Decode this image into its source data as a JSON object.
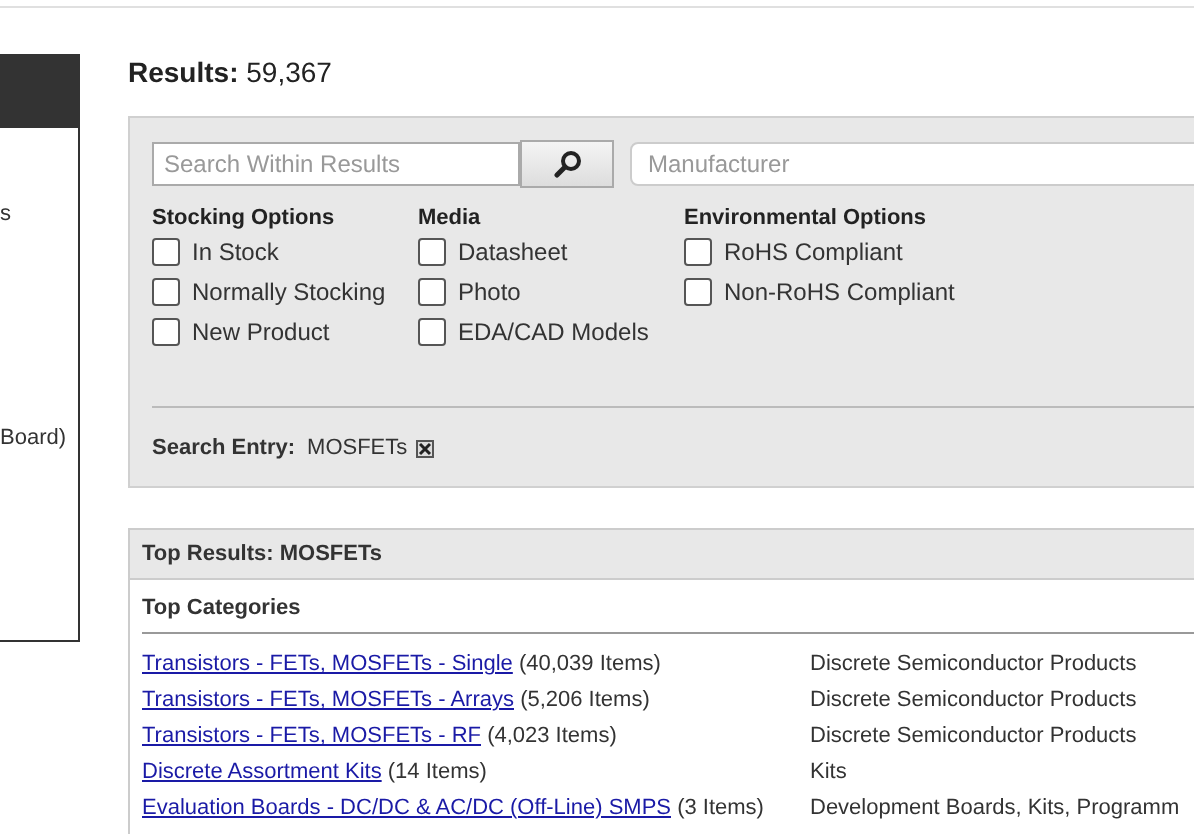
{
  "sidebar": {
    "fragments": [
      "s",
      "Board)"
    ]
  },
  "results": {
    "label": "Results:",
    "count": "59,367"
  },
  "filters": {
    "search": {
      "placeholder": "Search Within Results"
    },
    "manufacturer": {
      "placeholder": "Manufacturer"
    },
    "groups": [
      {
        "title": "Stocking Options",
        "options": [
          {
            "label": "In Stock",
            "checked": false
          },
          {
            "label": "Normally Stocking",
            "checked": false
          },
          {
            "label": "New Product",
            "checked": false
          }
        ]
      },
      {
        "title": "Media",
        "options": [
          {
            "label": "Datasheet",
            "checked": false
          },
          {
            "label": "Photo",
            "checked": false
          },
          {
            "label": "EDA/CAD Models",
            "checked": false
          }
        ]
      },
      {
        "title": "Environmental Options",
        "options": [
          {
            "label": "RoHS Compliant",
            "checked": false
          },
          {
            "label": "Non-RoHS Compliant",
            "checked": false
          }
        ]
      }
    ],
    "search_entry": {
      "label": "Search Entry:",
      "value": "MOSFETs"
    }
  },
  "top_results": {
    "title": "Top Results: MOSFETs",
    "section": "Top Categories",
    "rows": [
      {
        "link": "Transistors - FETs, MOSFETs - Single",
        "count": "(40,039 Items)",
        "category": "Discrete Semiconductor Products"
      },
      {
        "link": "Transistors - FETs, MOSFETs - Arrays",
        "count": "(5,206 Items)",
        "category": "Discrete Semiconductor Products"
      },
      {
        "link": "Transistors - FETs, MOSFETs - RF",
        "count": "(4,023 Items)",
        "category": "Discrete Semiconductor Products"
      },
      {
        "link": "Discrete Assortment Kits",
        "count": "(14 Items)",
        "category": "Kits"
      },
      {
        "link": "Evaluation Boards - DC/DC & AC/DC (Off-Line) SMPS",
        "count": "(3 Items)",
        "category": "Development Boards, Kits, Programm"
      }
    ]
  }
}
